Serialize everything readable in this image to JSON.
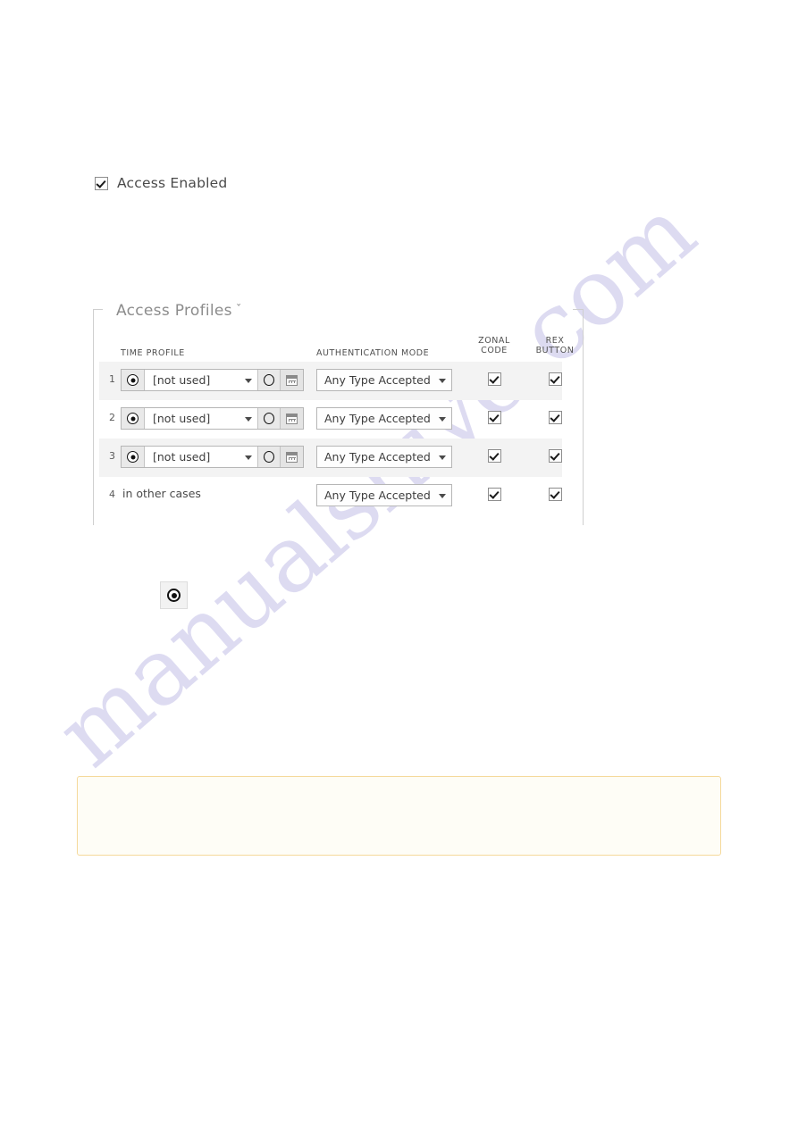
{
  "access_enabled": {
    "label": "Access Enabled",
    "checked": true
  },
  "panel": {
    "title": "Access Profiles",
    "caret": "ˇ"
  },
  "table": {
    "headers": {
      "time_profile": "TIME PROFILE",
      "authentication_mode": "AUTHENTICATION MODE",
      "zonal_code_line1": "ZONAL",
      "zonal_code_line2": "CODE",
      "rex_button_line1": "REX",
      "rex_button_line2": "BUTTON"
    },
    "rows": [
      {
        "number": "1",
        "time_profile": "[not used]",
        "authentication_mode": "Any Type Accepted",
        "zonal_code": true,
        "rex_button": true,
        "has_time_controls": true
      },
      {
        "number": "2",
        "time_profile": "[not used]",
        "authentication_mode": "Any Type Accepted",
        "zonal_code": true,
        "rex_button": true,
        "has_time_controls": true
      },
      {
        "number": "3",
        "time_profile": "[not used]",
        "authentication_mode": "Any Type Accepted",
        "zonal_code": true,
        "rex_button": true,
        "has_time_controls": true
      },
      {
        "number": "4",
        "time_profile": "in other cases",
        "authentication_mode": "Any Type Accepted",
        "zonal_code": true,
        "rex_button": true,
        "has_time_controls": false
      }
    ]
  },
  "standalone_button": {
    "icon": "target-icon"
  },
  "notice": {
    "text": ""
  },
  "watermark": {
    "text": "manualshive.com"
  },
  "colors": {
    "notice_border": "#f5d99a",
    "notice_background": "#fefdf6",
    "panel_border": "#cfcfcf",
    "alt_row": "#f3f3f3",
    "watermark": "#c9c6ea"
  }
}
